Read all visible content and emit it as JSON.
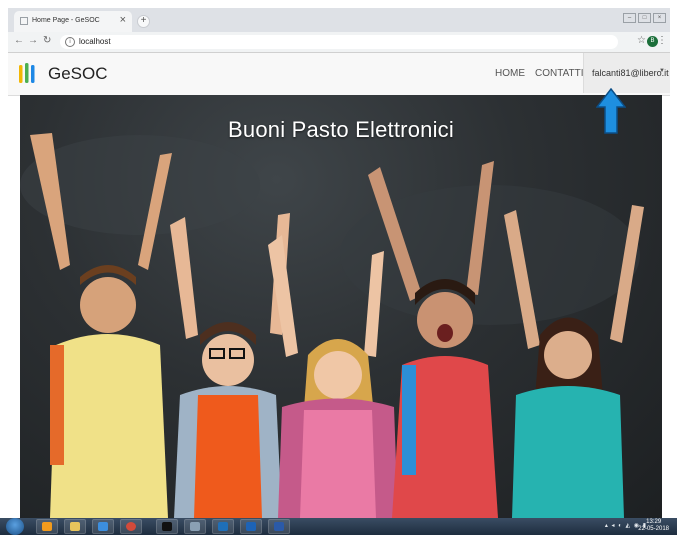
{
  "browser": {
    "tab_title": "Home Page - GeSOC",
    "tab_close": "×",
    "new_tab": "+",
    "url": "localhost",
    "profile_initial": "B"
  },
  "site": {
    "brand": "GeSOC",
    "nav": {
      "home": "HOME",
      "contact": "CONTATTI"
    },
    "user_email": "falcanti81@libero.it"
  },
  "hero": {
    "title": "Buoni Pasto Elettronici"
  },
  "taskbar": {
    "clock_time": "13:29",
    "clock_date": "22-05-2018"
  },
  "colors": {
    "accent_arrow": "#1e8fe0",
    "logo_yellow": "#f2b705",
    "logo_green": "#4caf50",
    "logo_blue": "#1e88e5"
  }
}
